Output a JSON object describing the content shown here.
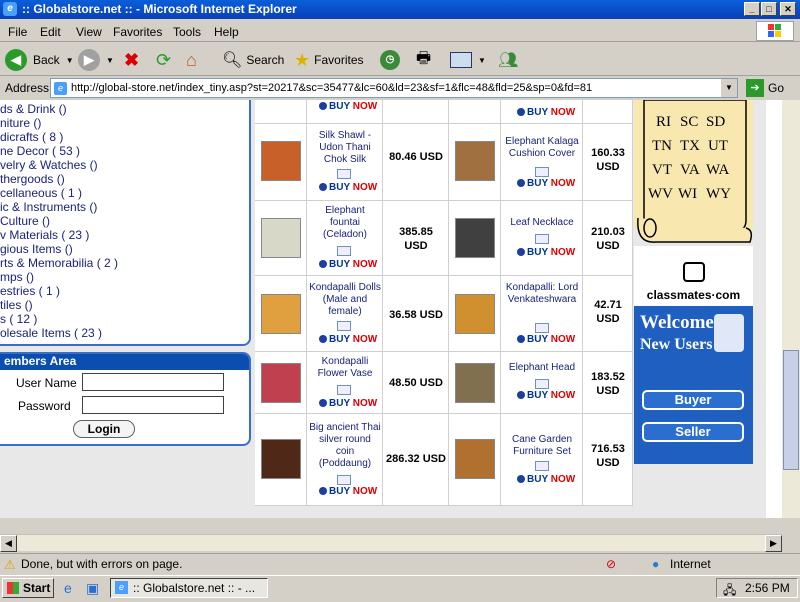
{
  "window": {
    "title": ":: Globalstore.net :: - Microsoft Internet Explorer"
  },
  "menu": [
    "File",
    "Edit",
    "View",
    "Favorites",
    "Tools",
    "Help"
  ],
  "toolbar": {
    "back": "Back",
    "search": "Search",
    "favorites": "Favorites"
  },
  "address": {
    "label": "Address",
    "url": "http://global-store.net/index_tiny.asp?st=20217&sc=35477&lc=60&ld=23&sf=1&flc=48&fld=25&sp=0&fd=81",
    "go": "Go"
  },
  "categories": [
    "ds & Drink ()",
    "niture ()",
    "dicrafts ( 8 )",
    "ne Decor ( 53 )",
    "velry & Watches ()",
    "thergoods ()",
    "cellaneous ( 1 )",
    "ic & Instruments ()",
    " Culture ()",
    "v Materials ( 23 )",
    "gious Items ()",
    "rts & Memorabilia ( 2 )",
    "mps ()",
    "estries ( 1 )",
    "tiles ()",
    "s ( 12 )",
    "olesale Items ( 23 )"
  ],
  "members": {
    "title": "embers Area",
    "user_label": "User Name",
    "pass_label": "Password",
    "login": "Login"
  },
  "buy_label_1": "BUY",
  "buy_label_2": "NOW",
  "products": [
    [
      {
        "name": "Silk Shawl - Udon Thani Chok Silk",
        "price": "80.46 USD"
      },
      {
        "name": "Elephant Kalaga Cushion Cover",
        "price": "160.33 USD"
      }
    ],
    [
      {
        "name": "Elephant fountai (Celadon)",
        "price": "385.85 USD"
      },
      {
        "name": "Leaf Necklace",
        "price": "210.03 USD"
      }
    ],
    [
      {
        "name": "Kondapalli Dolls (Male and female)",
        "price": "36.58 USD"
      },
      {
        "name": "Kondapalli: Lord Venkateshwara",
        "price": "42.71 USD"
      }
    ],
    [
      {
        "name": "Kondapalli Flower Vase",
        "price": "48.50 USD"
      },
      {
        "name": "Elephant Head",
        "price": "183.52 USD"
      }
    ],
    [
      {
        "name": "Big ancient Thai silver round coin (Poddaung)",
        "price": "286.32 USD"
      },
      {
        "name": "Cane Garden Furniture Set",
        "price": "716.53 USD"
      }
    ]
  ],
  "states": [
    "RI",
    "SC",
    "SD",
    "TN",
    "TX",
    "UT",
    "VT",
    "VA",
    "WA",
    "WV",
    "WI",
    "WY"
  ],
  "classmates": "classmates·com",
  "welcome": {
    "line1": "Welcome",
    "line2": "New Users",
    "buyer": "Buyer",
    "seller": "Seller"
  },
  "status": {
    "text": "Done, but with errors on page.",
    "zone": "Internet"
  },
  "taskbar": {
    "start": "Start",
    "task": ":: Globalstore.net :: - ...",
    "clock": "2:56 PM"
  }
}
